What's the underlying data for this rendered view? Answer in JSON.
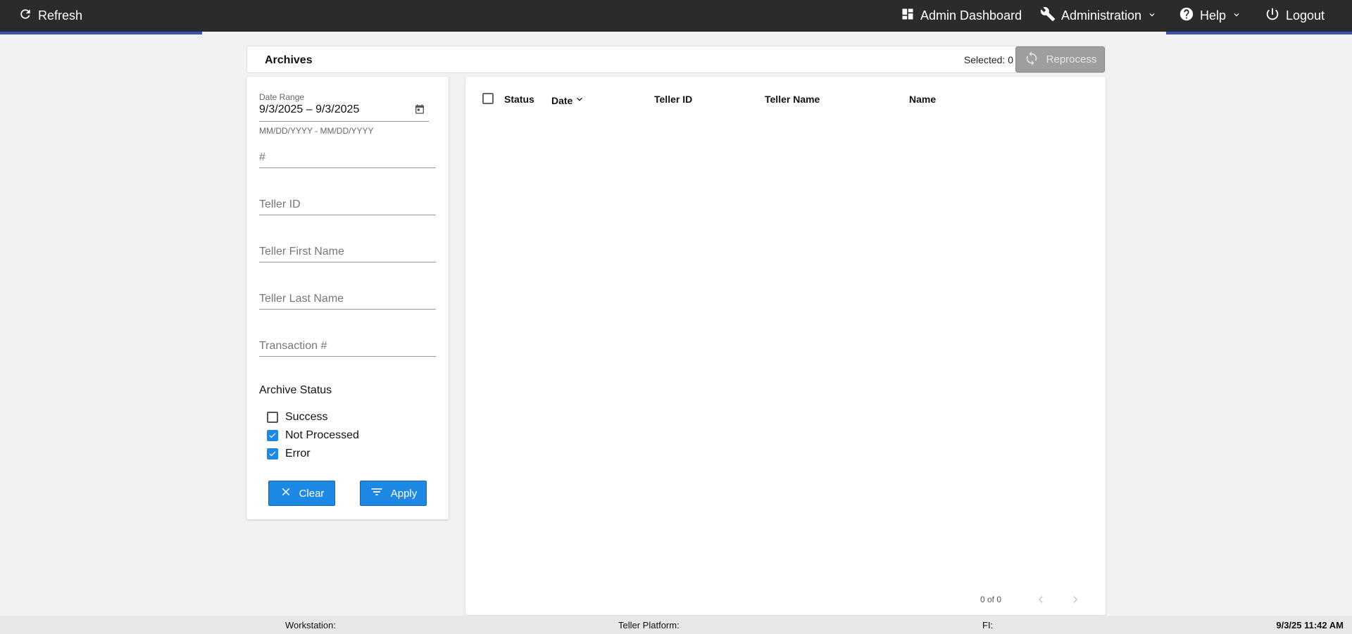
{
  "topbar": {
    "refresh_label": "Refresh",
    "admin_dashboard_label": "Admin Dashboard",
    "administration_label": "Administration",
    "help_label": "Help",
    "logout_label": "Logout"
  },
  "header": {
    "title": "Archives",
    "selected_label": "Selected: 0",
    "reprocess_label": "Reprocess"
  },
  "filters": {
    "date_range_label": "Date Range",
    "date_range_value": "9/3/2025 – 9/3/2025",
    "date_range_hint": "MM/DD/YYYY - MM/DD/YYYY",
    "number_placeholder": "#",
    "teller_id_placeholder": "Teller ID",
    "teller_first_name_placeholder": "Teller First Name",
    "teller_last_name_placeholder": "Teller Last Name",
    "transaction_placeholder": "Transaction #",
    "archive_status_title": "Archive Status",
    "statuses": [
      {
        "label": "Success",
        "checked": false
      },
      {
        "label": "Not Processed",
        "checked": true
      },
      {
        "label": "Error",
        "checked": true
      }
    ],
    "clear_label": "Clear",
    "apply_label": "Apply"
  },
  "table": {
    "columns": [
      "Status",
      "Date",
      "Teller ID",
      "Teller Name",
      "Name"
    ],
    "sort_column": "Date",
    "rows": [],
    "pager_text": "0 of 0"
  },
  "footer": {
    "workstation_label": "Workstation:",
    "teller_platform_label": "Teller Platform:",
    "fi_label": "FI:",
    "datetime": "9/3/25 11:42 AM"
  },
  "colors": {
    "topbar_bg": "#2b2b2b",
    "accent": "#3f51b5",
    "primary_button": "#1e88e5",
    "disabled_button": "#9e9e9e"
  }
}
